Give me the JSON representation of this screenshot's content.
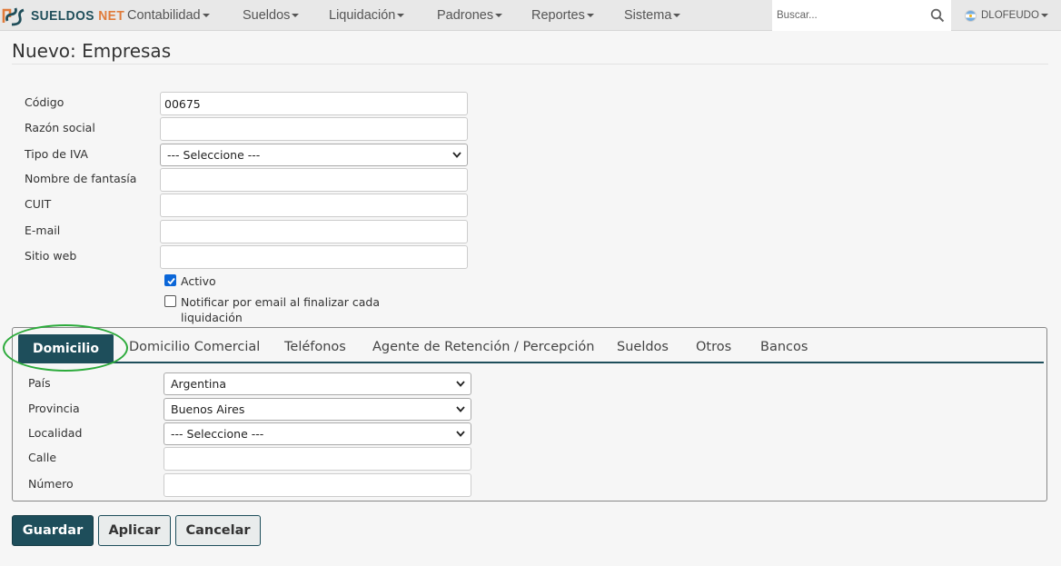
{
  "brand": {
    "name_main": "SUELDOS",
    "name_accent": "NET"
  },
  "nav": {
    "menus": [
      "Contabilidad",
      "Sueldos",
      "Liquidación",
      "Padrones",
      "Reportes",
      "Sistema"
    ],
    "search_placeholder": "Buscar...",
    "user": "DLOFEUDO"
  },
  "page": {
    "title": "Nuevo: Empresas"
  },
  "form": {
    "codigo_label": "Código",
    "codigo_value": "00675",
    "razon_social_label": "Razón social",
    "razon_social_value": "",
    "tipo_iva_label": "Tipo de IVA",
    "tipo_iva_value": "--- Seleccione ---",
    "fantasia_label": "Nombre de fantasía",
    "fantasia_value": "",
    "cuit_label": "CUIT",
    "cuit_value": "",
    "email_label": "E-mail",
    "email_value": "",
    "web_label": "Sitio web",
    "web_value": "",
    "activo_label": "Activo",
    "activo_checked": true,
    "notificar_label_line1": "Notificar por email al finalizar cada",
    "notificar_label_line2": "liquidación",
    "notificar_checked": false
  },
  "tabs": {
    "items": [
      "Domicilio",
      "Domicilio Comercial",
      "Teléfonos",
      "Agente de Retención / Percepción",
      "Sueldos",
      "Otros",
      "Bancos"
    ],
    "active": "Domicilio"
  },
  "domicilio": {
    "pais_label": "País",
    "pais_value": "Argentina",
    "provincia_label": "Provincia",
    "provincia_value": "Buenos Aires",
    "localidad_label": "Localidad",
    "localidad_value": "--- Seleccione ---",
    "calle_label": "Calle",
    "calle_value": "",
    "numero_label": "Número",
    "numero_value": ""
  },
  "buttons": {
    "save": "Guardar",
    "apply": "Aplicar",
    "cancel": "Cancelar"
  },
  "colors": {
    "primary": "#1e4e5b",
    "brand_accent": "#e07b3a",
    "highlight": "#2dab3c",
    "checkbox": "#0a66d8"
  }
}
